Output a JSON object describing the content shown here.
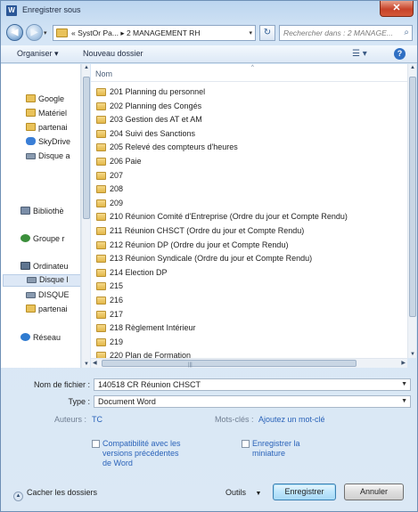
{
  "window": {
    "title": "Enregistrer sous",
    "app_icon": "W",
    "close_glyph": "✕"
  },
  "navigation": {
    "back_glyph": "◀",
    "forward_glyph": "▶",
    "history_glyph": "▾",
    "address_prefix": "«",
    "address_path": [
      "SystOr Pa...",
      "2 MANAGEMENT RH"
    ],
    "address_separator": "▸",
    "refresh_glyph": "↻",
    "search_placeholder": "Rechercher dans : 2 MANAGE..."
  },
  "toolbar": {
    "organize_label": "Organiser ▾",
    "new_folder_label": "Nouveau dossier",
    "views_glyph": "☰ ▾",
    "help_glyph": "?"
  },
  "sidebar": {
    "items": [
      {
        "label": "Google",
        "icon": "folder-icon"
      },
      {
        "label": "Matériel",
        "icon": "folder-icon"
      },
      {
        "label": "partenai",
        "icon": "folder-icon"
      },
      {
        "label": "SkyDrive",
        "icon": "cloud-icon"
      },
      {
        "label": "Disque a",
        "icon": "drive-icon"
      },
      {
        "label": "Bibliothè",
        "icon": "library-icon"
      },
      {
        "label": "Groupe r",
        "icon": "homegroup-icon"
      },
      {
        "label": "Ordinateu",
        "icon": "computer-icon"
      },
      {
        "label": "Disque l",
        "icon": "drive-icon"
      },
      {
        "label": "DISQUE",
        "icon": "drive-icon"
      },
      {
        "label": "partenai",
        "icon": "folder-icon"
      },
      {
        "label": "Réseau",
        "icon": "network-icon"
      }
    ]
  },
  "filelist": {
    "column_name": "Nom",
    "sort_glyph": "^",
    "folders": [
      "201 Planning du personnel",
      "202 Planning des Congés",
      "203 Gestion des AT et AM",
      "204 Suivi des Sanctions",
      "205 Relevé des compteurs d'heures",
      "206 Paie",
      "207",
      "208",
      "209",
      "210 Réunion Comité d'Entreprise (Ordre du jour et Compte Rendu)",
      "211 Réunion CHSCT (Ordre du jour et Compte Rendu)",
      "212 Réunion DP (Ordre du jour et Compte Rendu)",
      "213 Réunion Syndicale (Ordre du jour et Compte Rendu)",
      "214 Election DP",
      "215",
      "216",
      "217",
      "218 Règlement Intérieur",
      "219",
      "220 Plan de Formation"
    ]
  },
  "scroll": {
    "up": "▲",
    "down": "▼",
    "left": "◀",
    "right": "▶",
    "grip": "|||"
  },
  "form": {
    "filename_label": "Nom de fichier :",
    "filename_value": "140518 CR Réunion CHSCT",
    "type_label": "Type :",
    "type_value": "Document Word",
    "dropdown_glyph": "▼",
    "authors_label": "Auteurs :",
    "authors_value": "TC",
    "tags_label": "Mots-clés :",
    "tags_value": "Ajoutez un mot-clé",
    "compat_label_1": "Compatibilité avec les",
    "compat_label_2": "versions précédentes",
    "compat_label_3": "de Word",
    "thumb_label_1": "Enregistrer la",
    "thumb_label_2": "miniature",
    "hide_folders_label": "Cacher les dossiers",
    "hide_glyph": "▲",
    "tools_label": "Outils",
    "tools_glyph": "▼",
    "save_label": "Enregistrer",
    "cancel_label": "Annuler"
  }
}
